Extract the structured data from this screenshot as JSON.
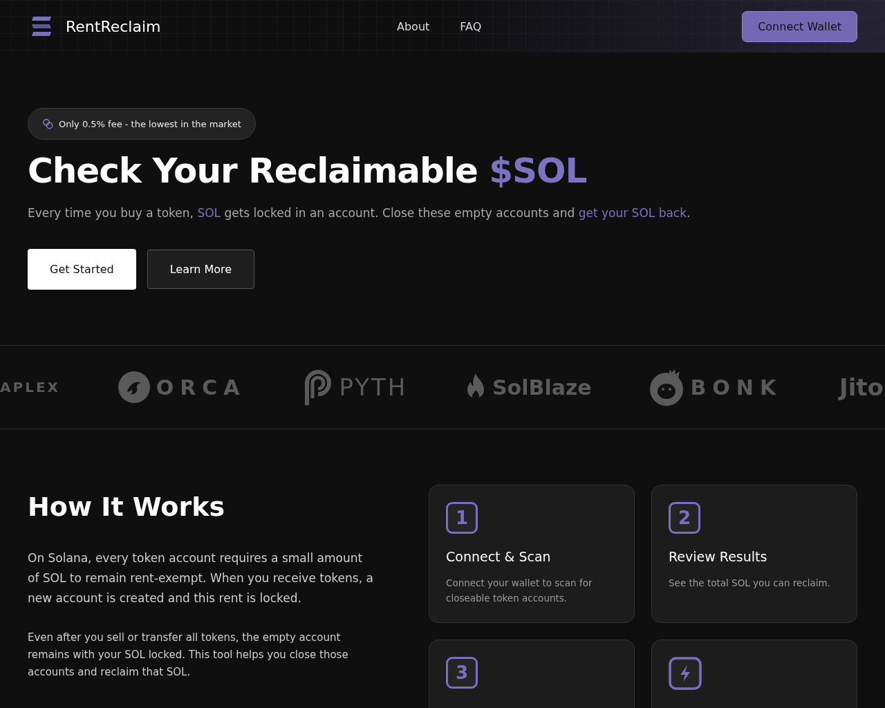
{
  "header": {
    "brand": "RentReclaim",
    "nav": [
      {
        "label": "About"
      },
      {
        "label": "FAQ"
      }
    ],
    "connect_button": "Connect Wallet"
  },
  "hero": {
    "badge": "Only 0.5% fee - the lowest in the market",
    "title": [
      {
        "text": "Check Your Reclaimable ",
        "accent": false
      },
      {
        "text": "$SOL",
        "accent": true
      }
    ],
    "subtitle": [
      {
        "text": "Every time you buy a token, ",
        "accent": false
      },
      {
        "text": "SOL",
        "accent": true
      },
      {
        "text": " gets locked in an account. Close these empty accounts and ",
        "accent": false
      },
      {
        "text": "get your SOL back",
        "accent": true
      },
      {
        "text": ".",
        "accent": false
      }
    ],
    "buttons": [
      {
        "label": "Get Started",
        "kind": "primary"
      },
      {
        "label": "Learn More",
        "kind": "secondary"
      }
    ]
  },
  "partners": [
    {
      "name": "APLEX",
      "kind": "plain"
    },
    {
      "name": "ORCA",
      "kind": "orca"
    },
    {
      "name": "PYTH",
      "kind": "pyth"
    },
    {
      "name": "SolBlaze",
      "kind": "flame"
    },
    {
      "name": "BONK",
      "kind": "bonk"
    },
    {
      "name": "Jito",
      "kind": "plain"
    }
  ],
  "how_it_works": {
    "title": "How It Works",
    "paragraphs": [
      "On Solana, every token account requires a small amount of SOL to remain rent-exempt. When you receive tokens, a new account is created and this rent is locked.",
      "Even after you sell or transfer all tokens, the empty account remains with your SOL locked. This tool helps you close those accounts and reclaim that SOL."
    ],
    "steps": [
      {
        "kind": "number",
        "number": "1",
        "title": "Connect & Scan",
        "text": "Connect your wallet to scan for closeable token accounts."
      },
      {
        "kind": "number",
        "number": "2",
        "title": "Review Results",
        "text": "See the total SOL you can reclaim."
      },
      {
        "kind": "number",
        "number": "3"
      },
      {
        "kind": "bolt"
      }
    ]
  }
}
